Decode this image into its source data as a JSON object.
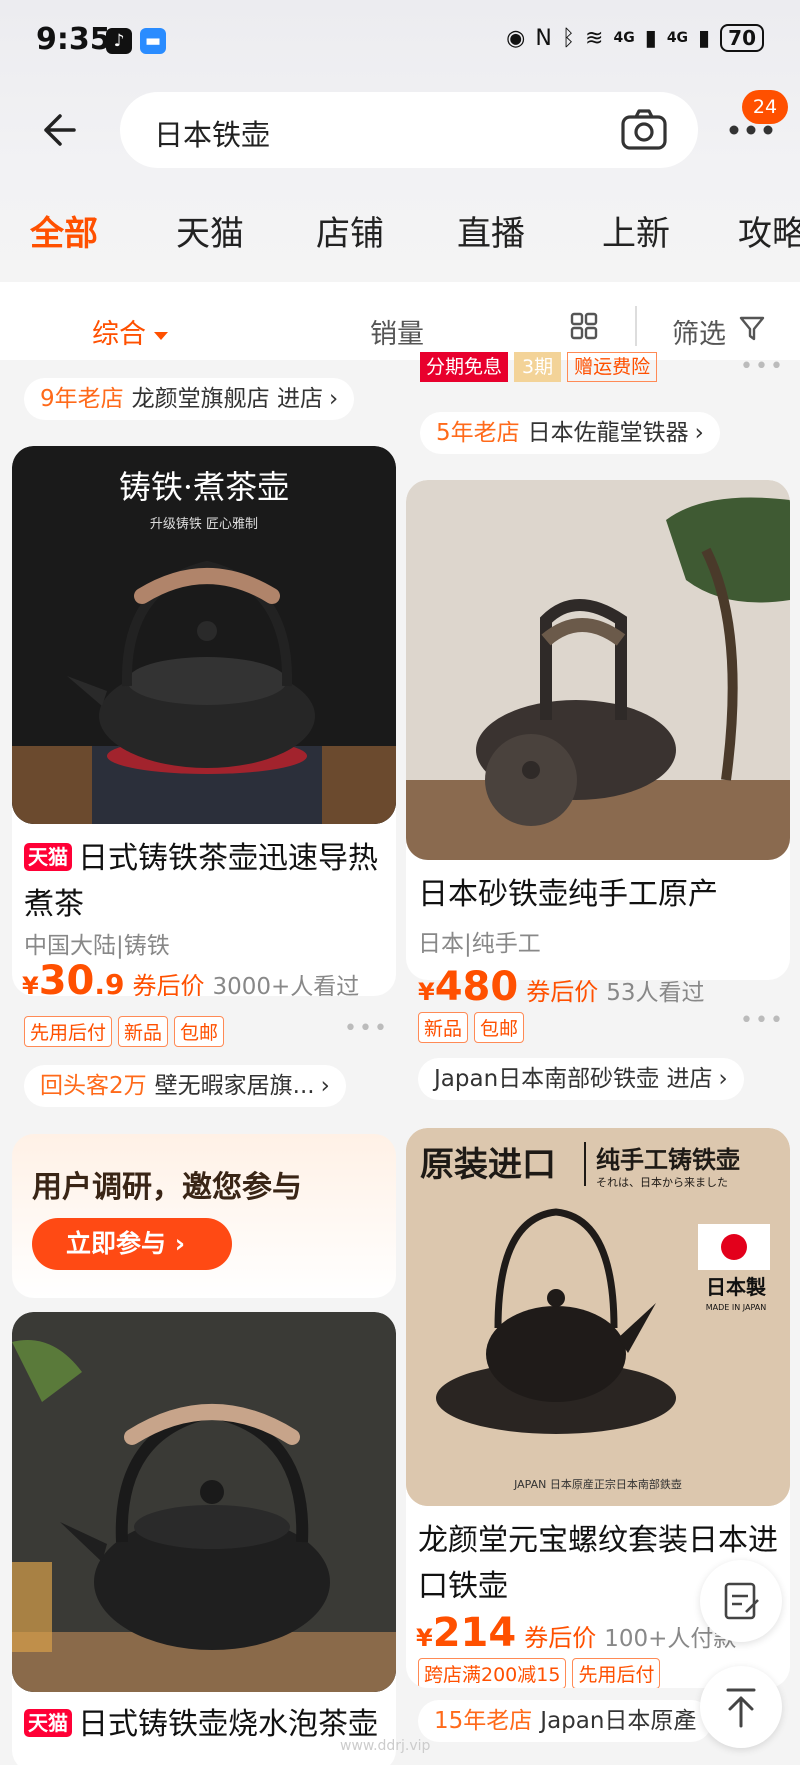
{
  "status_bar": {
    "time": "9:35",
    "battery": "70",
    "signal1": "4G",
    "signal2": "4G"
  },
  "search": {
    "query": "日本铁壶",
    "notification_count": "24"
  },
  "tabs": [
    "全部",
    "天猫",
    "店铺",
    "直播",
    "上新",
    "攻略"
  ],
  "sort": {
    "comprehensive": "综合",
    "sales": "销量",
    "filter": "筛选"
  },
  "feed": {
    "left_top_store": {
      "age": "9年老店",
      "name": "龙颜堂旗舰店 进店"
    },
    "right_top_promos": {
      "a": "分期免息",
      "b": "3期",
      "c": "赠运费险"
    },
    "right_top_store": {
      "age": "5年老店",
      "name": "日本佐龍堂铁器"
    },
    "product1": {
      "image_title": "铸铁·煮茶壶",
      "image_subtitle": "升级铸铁 匠心雅制",
      "badge": "天猫",
      "title": "日式铸铁茶壶迅速导热煮茶",
      "attrs": "中国大陆|铸铁",
      "price_symbol": "¥",
      "price_int": "30",
      "price_dec": ".9",
      "after": "券后价",
      "seen": "3000+人看过",
      "tags": [
        "先用后付",
        "新品",
        "包邮"
      ],
      "store_age": "回头客2万",
      "store_name": "壁无暇家居旗..."
    },
    "product2": {
      "title": "日本砂铁壶纯手工原产",
      "attrs": "日本|纯手工",
      "price_symbol": "¥",
      "price_int": "480",
      "after": "券后价",
      "seen": "53人看过",
      "tags": [
        "新品",
        "包邮"
      ],
      "store_name": "Japan日本南部砂铁壶 进店"
    },
    "survey": {
      "question": "用户调研，邀您参与",
      "button": "立即参与 ›"
    },
    "product3": {
      "image_title": "原装进口",
      "image_subtitle": "纯手工铸铁壶",
      "image_jp": "それは、日本から来ました",
      "image_made": "日本製",
      "image_made_en": "MADE IN JAPAN",
      "image_bottom": "JAPAN  日本原産正宗日本南部鉄壺",
      "title": "龙颜堂元宝螺纹套装日本进口铁壶",
      "price_symbol": "¥",
      "price_int": "214",
      "after": "券后价",
      "seen": "100+人付款",
      "tags": [
        "跨店满200减15",
        "先用后付"
      ],
      "store_age": "15年老店",
      "store_name": "Japan日本原產"
    },
    "product4": {
      "badge": "天猫",
      "title": "日式铸铁壶烧水泡茶壶"
    }
  },
  "watermark": "www.ddrj.vip"
}
